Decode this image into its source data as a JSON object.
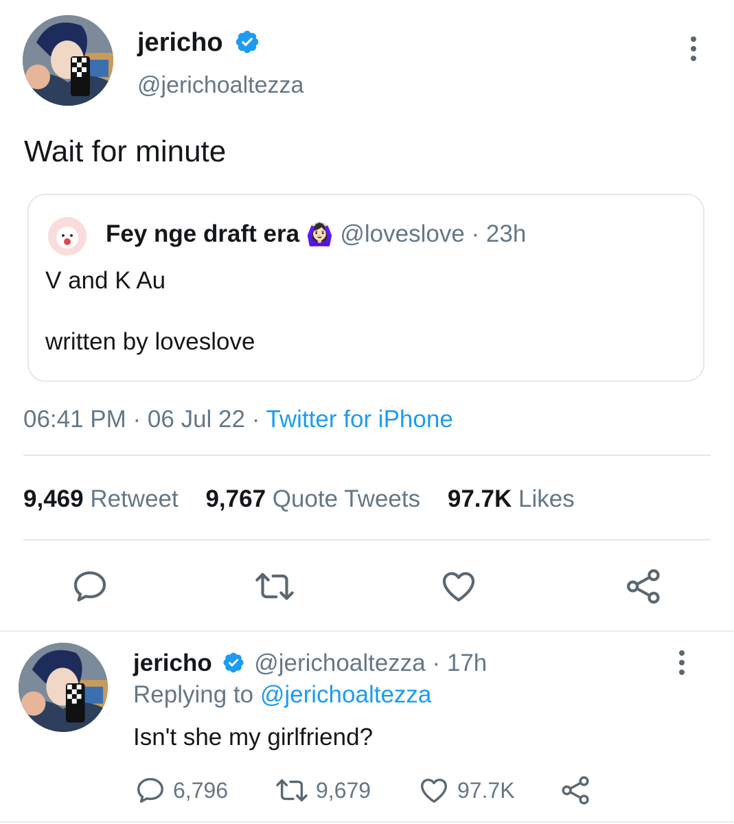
{
  "main_tweet": {
    "author_name": "jericho",
    "handle": "@jerichoaltezza",
    "text": "Wait for minute",
    "timestamp": "06:41 PM · 06 Jul 22 · ",
    "source": "Twitter for iPhone",
    "stats": {
      "retweets_count": "9,469",
      "retweets_label": "Retweet",
      "quotes_count": "9,767",
      "quotes_label": "Quote Tweets",
      "likes_count": "97.7K",
      "likes_label": "Likes"
    },
    "icons": [
      "reply-icon",
      "retweet-icon",
      "like-icon",
      "share-icon"
    ]
  },
  "quoted_tweet": {
    "author_name": "Fey nge draft era",
    "emoji": "🙆🏻‍♀️",
    "handle": "@loveslove",
    "time": "· 23h",
    "line1": "V and K Au",
    "line2": "written by loveslove"
  },
  "reply_tweet": {
    "author_name": "jericho",
    "handle": "@jerichoaltezza",
    "time": "· 17h",
    "replying_to_label": "Replying to",
    "replying_to_handle": "@jerichoaltezza",
    "text": "Isn't she my girlfriend?",
    "reply_count": "6,796",
    "retweet_count": "9,679",
    "like_count": "97.7K"
  },
  "colors": {
    "accent": "#1d9bf0",
    "secondary_text": "#657786",
    "divider": "#e1e8ed"
  }
}
